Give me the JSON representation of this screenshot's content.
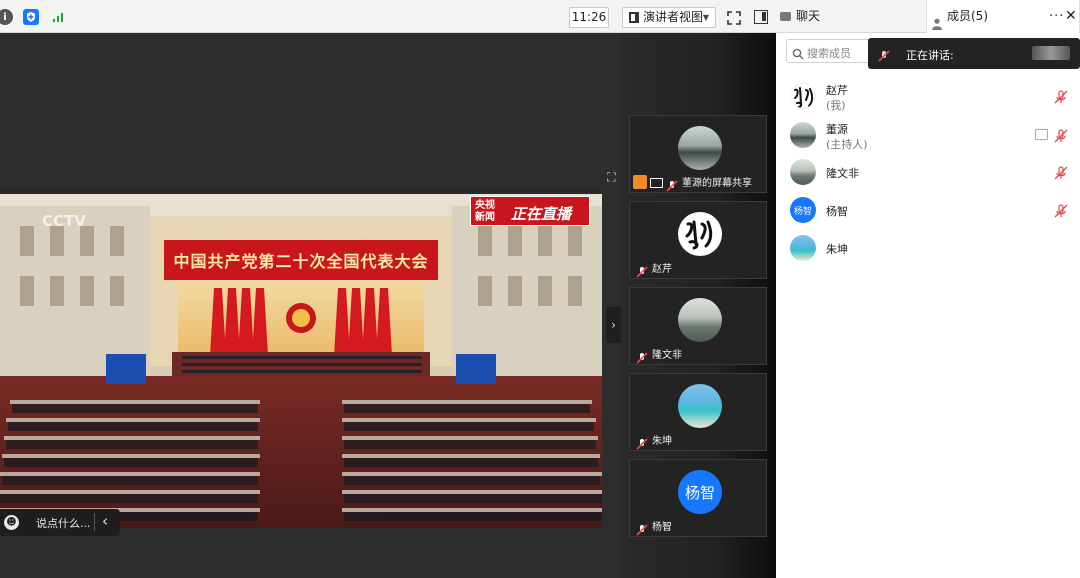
{
  "toolbar": {
    "clock": "11:26",
    "view_mode": "演讲者视图"
  },
  "right_panel": {
    "chat_tab": "聊天",
    "members_tab": "成员(5)"
  },
  "stage": {
    "stream_banner": "中国共产党第二十次全国代表大会",
    "live_badge_cn": "央视新闻",
    "live_badge": "正在直播",
    "side_screen_text": "中国共产党第二十次全国代表大会",
    "chat_placeholder": "说点什么..."
  },
  "gallery": [
    {
      "name": "董源的屏幕共享",
      "kind": "landscape"
    },
    {
      "name": "赵芹",
      "kind": "calligraphy"
    },
    {
      "name": "隆文非",
      "kind": "boat"
    },
    {
      "name": "朱坤",
      "kind": "beach"
    },
    {
      "name": "杨智",
      "kind": "initials",
      "initials": "杨智",
      "color": "#1677ff"
    }
  ],
  "members_panel": {
    "search_placeholder": "搜索成员",
    "speaking_label": "正在讲话:",
    "members": [
      {
        "name": "赵芹",
        "sub": "(我)",
        "muted": true
      },
      {
        "name": "董源",
        "sub": "(主持人)",
        "muted": true,
        "screen_share": true
      },
      {
        "name": "隆文非",
        "sub": "",
        "muted": true
      },
      {
        "name": "杨智",
        "sub": "",
        "muted": true,
        "initials": "杨智"
      },
      {
        "name": "朱坤",
        "sub": "",
        "muted": false
      }
    ]
  },
  "colors": {
    "accent": "#1677ff",
    "muted_red": "#e5484d",
    "stage_bg": "#2d2d2d"
  }
}
